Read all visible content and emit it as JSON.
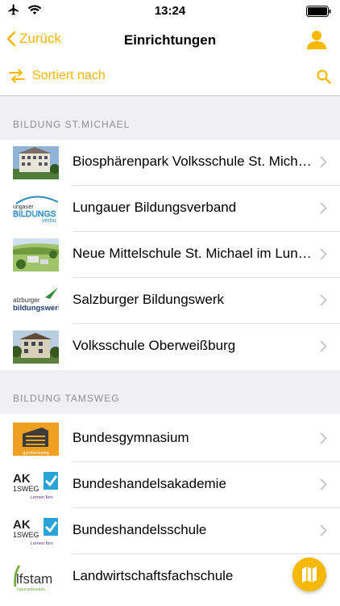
{
  "status_bar": {
    "time": "13:24"
  },
  "nav": {
    "back_label": "Zurück",
    "title": "Einrichtungen"
  },
  "toolbar": {
    "sort_label": "Sortiert nach"
  },
  "sections": [
    {
      "header": "BILDUNG ST.MICHAEL",
      "items": [
        {
          "label": "Biosphärenpark Volksschule St. Michael",
          "thumb": "photo-building"
        },
        {
          "label": "Lungauer Bildungsverband",
          "thumb": "logo-bildungsverbund"
        },
        {
          "label": "Neue Mittelschule St. Michael im Lungau",
          "thumb": "photo-landscape"
        },
        {
          "label": "Salzburger Bildungswerk",
          "thumb": "logo-salzburger-bildungswerk"
        },
        {
          "label": "Volksschule Oberweißburg",
          "thumb": "photo-school"
        }
      ]
    },
    {
      "header": "BILDUNG TAMSWEG",
      "items": [
        {
          "label": "Bundesgymnasium",
          "thumb": "logo-gymtamsweg"
        },
        {
          "label": "Bundeshandelsakademie",
          "thumb": "logo-ak-tamsweg"
        },
        {
          "label": "Bundeshandelsschule",
          "thumb": "logo-ak-tamsweg"
        },
        {
          "label": "Landwirtschaftsfachschule",
          "thumb": "logo-lfs-tamsweg"
        }
      ]
    }
  ],
  "thumb_text": {
    "bildungs_top": "ungauer",
    "bildungs_main": "BILDUNGS",
    "bildungs_sub": "verbu",
    "sbw_top": "alzburger",
    "sbw_main": "bildungswerk",
    "gym": "gymtamsweg",
    "ak_main": "AK",
    "ak_sub": "1SWEG",
    "ak_tag": "Lernen fürs",
    "lfs_main": "lfstam",
    "lfs_sub": "naturverbunden..."
  },
  "colors": {
    "accent": "#f6b800",
    "section_bg": "#efeff4",
    "section_text": "#8e8e93"
  }
}
